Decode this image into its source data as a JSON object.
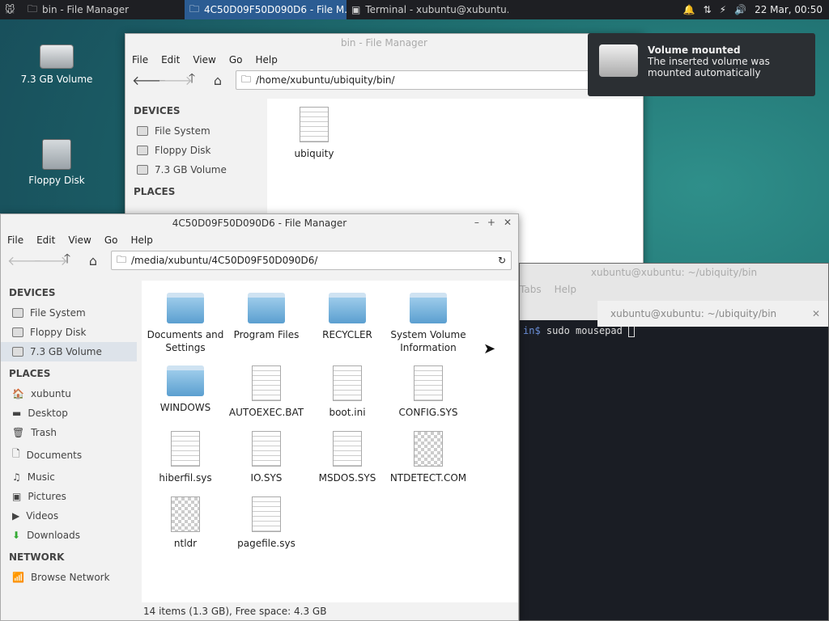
{
  "panel": {
    "tasks": [
      "bin - File Manager",
      "4C50D09F50D090D6 - File M...",
      "Terminal - xubuntu@xubuntu..."
    ],
    "clock": "22 Mar, 00:50"
  },
  "desktop": {
    "icons": [
      "7.3 GB Volume",
      "Floppy Disk"
    ]
  },
  "fm1": {
    "title": "bin - File Manager",
    "menu": [
      "File",
      "Edit",
      "View",
      "Go",
      "Help"
    ],
    "path": "/home/xubuntu/ubiquity/bin/",
    "devices_head": "DEVICES",
    "places_head": "PLACES",
    "devices": [
      "File System",
      "Floppy Disk",
      "7.3 GB Volume"
    ],
    "files": [
      "ubiquity"
    ]
  },
  "fm2": {
    "title": "4C50D09F50D090D6 - File Manager",
    "menu": [
      "File",
      "Edit",
      "View",
      "Go",
      "Help"
    ],
    "path": "/media/xubuntu/4C50D09F50D090D6/",
    "devices_head": "DEVICES",
    "places_head": "PLACES",
    "network_head": "NETWORK",
    "devices": [
      "File System",
      "Floppy Disk",
      "7.3 GB Volume"
    ],
    "places": [
      "xubuntu",
      "Desktop",
      "Trash",
      "Documents",
      "Music",
      "Pictures",
      "Videos",
      "Downloads"
    ],
    "network": [
      "Browse Network"
    ],
    "files": [
      "Documents and Settings",
      "Program Files",
      "RECYCLER",
      "System Volume Information",
      "WINDOWS",
      "AUTOEXEC.BAT",
      "boot.ini",
      "CONFIG.SYS",
      "hiberfil.sys",
      "IO.SYS",
      "MSDOS.SYS",
      "NTDETECT.COM",
      "ntldr",
      "pagefile.sys"
    ],
    "status": "14 items (1.3 GB), Free space: 4.3 GB"
  },
  "notify": {
    "title": "Volume mounted",
    "body": "The inserted volume was mounted automatically"
  },
  "term": {
    "title": "xubuntu@xubuntu: ~/ubiquity/bin",
    "menu": [
      "Tabs",
      "Help"
    ],
    "tab": "xubuntu@xubuntu: ~/ubiquity/bin",
    "prompt": "in$",
    "cmd": "sudo mousepad"
  }
}
